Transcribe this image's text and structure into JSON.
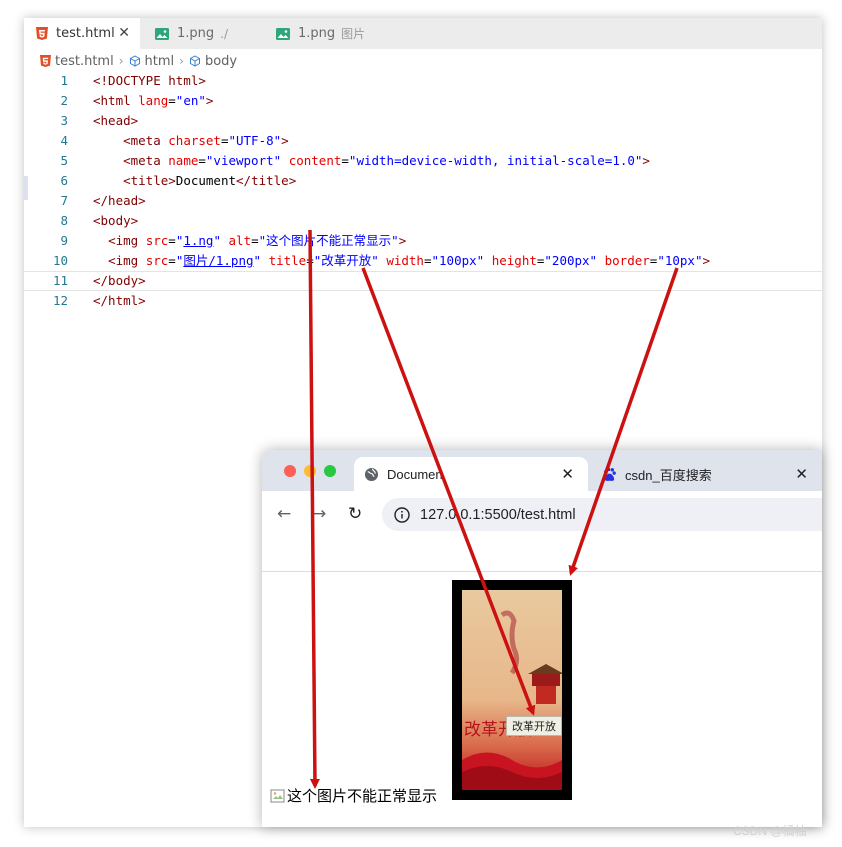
{
  "editor": {
    "tabs": [
      {
        "label": "test.html",
        "hint": ""
      },
      {
        "label": "1.png",
        "hint": "./"
      },
      {
        "label": "1.png",
        "hint": "图片"
      }
    ],
    "breadcrumb": [
      "test.html",
      "html",
      "body"
    ]
  },
  "code_lines": [
    {
      "n": "1",
      "segs": [
        [
          "tg",
          "<!DOCTYPE html>"
        ]
      ]
    },
    {
      "n": "2",
      "segs": [
        [
          "tg",
          "<html "
        ],
        [
          "at",
          "lang"
        ],
        [
          "tx",
          "="
        ],
        [
          "vl",
          "\"en\""
        ],
        [
          "tg",
          ">"
        ]
      ]
    },
    {
      "n": "3",
      "segs": [
        [
          "tg",
          "<head>"
        ]
      ]
    },
    {
      "n": "4",
      "segs": [
        [
          "tx",
          "    "
        ],
        [
          "tg",
          "<meta "
        ],
        [
          "at",
          "charset"
        ],
        [
          "tx",
          "="
        ],
        [
          "vl",
          "\"UTF-8\""
        ],
        [
          "tg",
          ">"
        ]
      ]
    },
    {
      "n": "5",
      "segs": [
        [
          "tx",
          "    "
        ],
        [
          "tg",
          "<meta "
        ],
        [
          "at",
          "name"
        ],
        [
          "tx",
          "="
        ],
        [
          "vl",
          "\"viewport\""
        ],
        [
          "tx",
          " "
        ],
        [
          "at",
          "content"
        ],
        [
          "tx",
          "="
        ],
        [
          "vl",
          "\"width=device-width, initial-scale=1.0\""
        ],
        [
          "tg",
          ">"
        ]
      ]
    },
    {
      "n": "6",
      "segs": [
        [
          "tx",
          "    "
        ],
        [
          "tg",
          "<title>"
        ],
        [
          "tx",
          "Document"
        ],
        [
          "tg",
          "</title>"
        ]
      ]
    },
    {
      "n": "7",
      "segs": [
        [
          "tg",
          "</head>"
        ]
      ]
    },
    {
      "n": "8",
      "segs": [
        [
          "tg",
          "<body>"
        ]
      ]
    },
    {
      "n": "9",
      "segs": [
        [
          "tx",
          "  "
        ],
        [
          "tg",
          "<img "
        ],
        [
          "at",
          "src"
        ],
        [
          "tx",
          "="
        ],
        [
          "vl",
          "\""
        ],
        [
          "vl ul",
          "1.ng"
        ],
        [
          "vl",
          "\""
        ],
        [
          "tx",
          " "
        ],
        [
          "at",
          "alt"
        ],
        [
          "tx",
          "="
        ],
        [
          "vl",
          "\"这个图片不能正常显示\""
        ],
        [
          "tg",
          ">"
        ]
      ]
    },
    {
      "n": "10",
      "segs": [
        [
          "tx",
          "  "
        ],
        [
          "tg",
          "<img "
        ],
        [
          "at",
          "src"
        ],
        [
          "tx",
          "="
        ],
        [
          "vl",
          "\""
        ],
        [
          "vl ul",
          "图片/1.png"
        ],
        [
          "vl",
          "\""
        ],
        [
          "tx",
          " "
        ],
        [
          "at",
          "title"
        ],
        [
          "tx",
          "="
        ],
        [
          "vl",
          "\"改革开放\""
        ],
        [
          "tx",
          " "
        ],
        [
          "at",
          "width"
        ],
        [
          "tx",
          "="
        ],
        [
          "vl",
          "\"100px\""
        ],
        [
          "tx",
          " "
        ],
        [
          "at",
          "height"
        ],
        [
          "tx",
          "="
        ],
        [
          "vl",
          "\"200px\""
        ],
        [
          "tx",
          " "
        ],
        [
          "at",
          "border"
        ],
        [
          "tx",
          "="
        ],
        [
          "vl",
          "\"10px\""
        ],
        [
          "tg",
          ">"
        ]
      ]
    },
    {
      "n": "11",
      "segs": [
        [
          "tg",
          "</body>"
        ]
      ],
      "current": true
    },
    {
      "n": "12",
      "segs": [
        [
          "tg",
          "</html>"
        ]
      ]
    }
  ],
  "browser": {
    "tabs": [
      {
        "label": "Documen"
      },
      {
        "label": "csdn_百度搜索"
      }
    ],
    "url": "127.0.0.1:5500/test.html",
    "image_title_tooltip": "改革开放",
    "image_text": "改革开放",
    "alt_text": "这个图片不能正常显示"
  },
  "watermark": "CSDN @橘柚",
  "colors": {
    "arrow": "#cc1111",
    "tag": "#800000",
    "attr": "#e50000",
    "value": "#0000ff",
    "line_number": "#237893"
  }
}
